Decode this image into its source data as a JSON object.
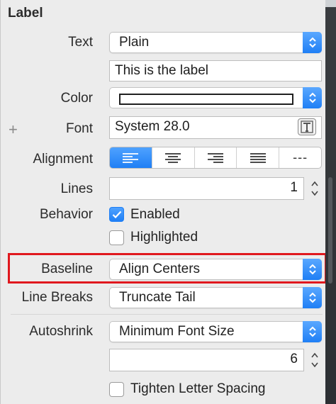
{
  "section": {
    "title": "Label"
  },
  "text": {
    "label": "Text",
    "value": "Plain",
    "content": "This is the label"
  },
  "color": {
    "label": "Color"
  },
  "font": {
    "label": "Font",
    "value": "System 28.0"
  },
  "alignment": {
    "label": "Alignment",
    "selected": "left",
    "last_symbol": "---"
  },
  "lines": {
    "label": "Lines",
    "value": "1"
  },
  "behavior": {
    "label": "Behavior",
    "enabled": {
      "label": "Enabled",
      "checked": true
    },
    "highlighted": {
      "label": "Highlighted",
      "checked": false
    }
  },
  "baseline": {
    "label": "Baseline",
    "value": "Align Centers"
  },
  "line_breaks": {
    "label": "Line Breaks",
    "value": "Truncate Tail"
  },
  "autoshrink": {
    "label": "Autoshrink",
    "value": "Minimum Font Size",
    "min_value": "6"
  },
  "tighten": {
    "label": "Tighten Letter Spacing",
    "checked": false
  },
  "colors": {
    "accent": "#1f7ff5",
    "highlight_border": "#e0181e"
  }
}
